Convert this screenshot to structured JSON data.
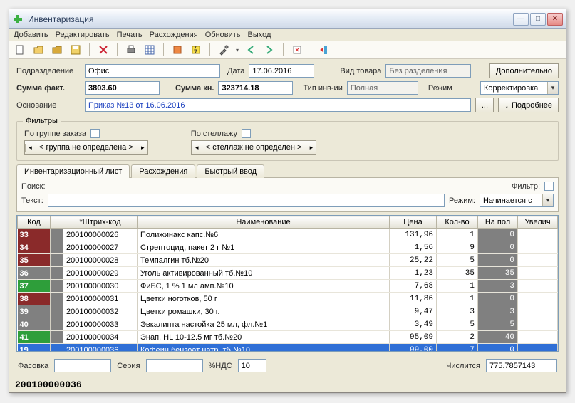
{
  "window": {
    "title": "Инвентаризация"
  },
  "menu": {
    "add": "Добавить",
    "edit": "Редактировать",
    "print": "Печать",
    "diff": "Расхождения",
    "refresh": "Обновить",
    "exit": "Выход"
  },
  "form": {
    "dept_label": "Подразделение",
    "dept_value": "Офис",
    "date_label": "Дата",
    "date_value": "17.06.2016",
    "goods_type_label": "Вид товара",
    "goods_type_value": "Без разделения",
    "more_btn": "Дополнительно",
    "sum_fact_label": "Сумма факт.",
    "sum_fact_value": "3803.60",
    "sum_kn_label": "Сумма кн.",
    "sum_kn_value": "323714.18",
    "inv_type_label": "Тип инв-ии",
    "inv_type_value": "Полная",
    "mode_label": "Режим",
    "mode_value": "Корректировка",
    "basis_label": "Основание",
    "basis_value": "Приказ №13 от 16.06.2016",
    "ellipsis": "...",
    "detail_btn": "Подробнее"
  },
  "filters": {
    "legend": "Фильтры",
    "by_order": "По группе заказа",
    "order_value": "< группа не определена >",
    "by_shelf": "По стеллажу",
    "shelf_value": "< стеллаж не определен >"
  },
  "tabs": {
    "t1": "Инвентаризационный лист",
    "t2": "Расхождения",
    "t3": "Быстрый ввод"
  },
  "search": {
    "label": "Поиск:",
    "text_label": "Текст:",
    "mode_label": "Режим:",
    "mode_value": "Начинается с",
    "filter_label": "Фильтр:"
  },
  "table": {
    "headers": {
      "code": "Код",
      "barcode": "*Штрих-код",
      "name": "Наименование",
      "price": "Цена",
      "qty": "Кол-во",
      "shelf": "На пол",
      "inc": "Увелич"
    },
    "rows": [
      {
        "code": "33",
        "code_bg": "#8a2a2a",
        "gap_bg": "#808080",
        "barcode": "200100000026",
        "name": "Полижинакс капс.№6",
        "price": "131,96",
        "qty": "1",
        "shelf": "0"
      },
      {
        "code": "34",
        "code_bg": "#8a2a2a",
        "gap_bg": "#808080",
        "barcode": "200100000027",
        "name": "Стрептоцид, пакет 2 г №1",
        "price": "1,56",
        "qty": "9",
        "shelf": "0"
      },
      {
        "code": "35",
        "code_bg": "#8a2a2a",
        "gap_bg": "#808080",
        "barcode": "200100000028",
        "name": "Темпалгин тб.№20",
        "price": "25,22",
        "qty": "5",
        "shelf": "0"
      },
      {
        "code": "36",
        "code_bg": "#808080",
        "gap_bg": "#808080",
        "barcode": "200100000029",
        "name": "Уголь активированный тб.№10",
        "price": "1,23",
        "qty": "35",
        "shelf": "35"
      },
      {
        "code": "37",
        "code_bg": "#2e9e3a",
        "gap_bg": "#808080",
        "barcode": "200100000030",
        "name": "ФиБС, 1 % 1 мл амп.№10",
        "price": "7,68",
        "qty": "1",
        "shelf": "3"
      },
      {
        "code": "38",
        "code_bg": "#8a2a2a",
        "gap_bg": "#808080",
        "barcode": "200100000031",
        "name": "Цветки ноготков, 50 г",
        "price": "11,86",
        "qty": "1",
        "shelf": "0"
      },
      {
        "code": "39",
        "code_bg": "#808080",
        "gap_bg": "#808080",
        "barcode": "200100000032",
        "name": "Цветки ромашки, 30 г.",
        "price": "9,47",
        "qty": "3",
        "shelf": "3"
      },
      {
        "code": "40",
        "code_bg": "#808080",
        "gap_bg": "#808080",
        "barcode": "200100000033",
        "name": "Эвкалипта настойка 25 мл, фл.№1",
        "price": "3,49",
        "qty": "5",
        "shelf": "5"
      },
      {
        "code": "41",
        "code_bg": "#2e9e3a",
        "gap_bg": "#808080",
        "barcode": "200100000034",
        "name": "Энап, HL 10-12.5 мг тб.№20",
        "price": "95,09",
        "qty": "2",
        "shelf": "40"
      },
      {
        "code": "19",
        "code_bg": "#2f6fd6",
        "gap_bg": "#2f6fd6",
        "barcode": "200100000036",
        "name": "Кофеин бензоат натр. тб.№10",
        "price": "99,00",
        "qty": "7",
        "shelf": "0",
        "selected": true
      }
    ]
  },
  "footer": {
    "pack_label": "Фасовка",
    "series_label": "Серия",
    "vat_label": "%НДС",
    "vat_value": "10",
    "counted_label": "Числится",
    "counted_value": "775.7857143"
  },
  "status": {
    "text": "200100000036"
  }
}
